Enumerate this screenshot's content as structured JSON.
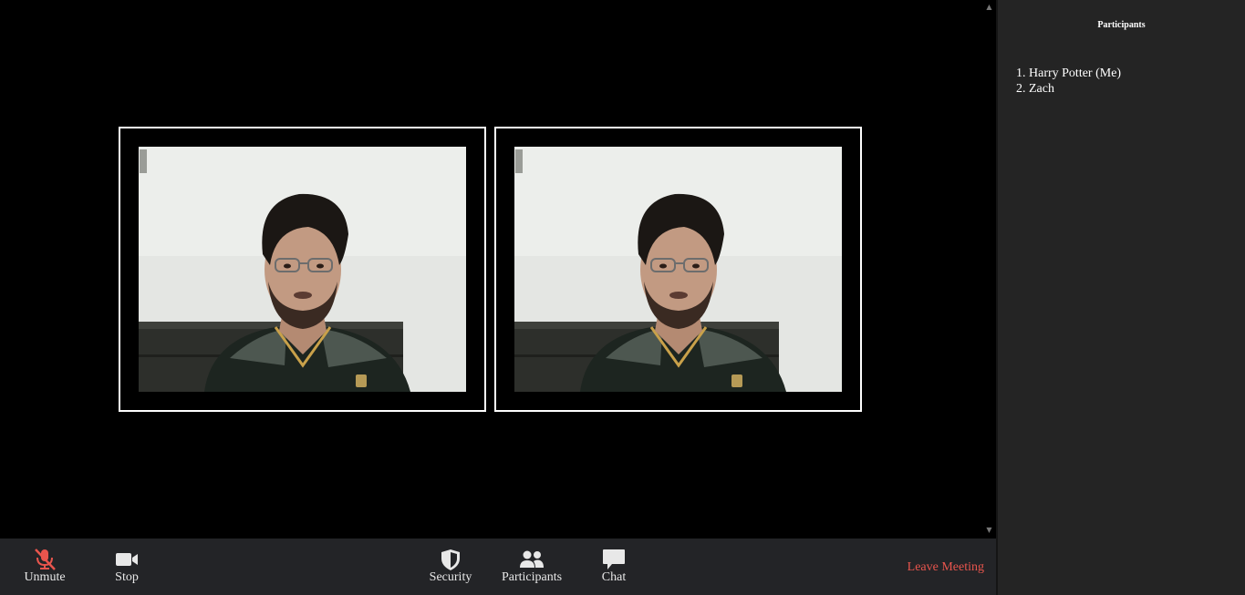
{
  "toolbar": {
    "unmute_label": "Unmute",
    "stop_label": "Stop",
    "security_label": "Security",
    "participants_label": "Participants",
    "chat_label": "Chat",
    "leave_label": "Leave Meeting",
    "icons": {
      "unmute": "muted-microphone-icon",
      "stop": "video-camera-icon",
      "security": "shield-icon",
      "participants": "people-icon",
      "chat": "chat-bubble-icon"
    },
    "colors": {
      "background": "#232427",
      "label": "#e8e8e8",
      "muted_icon": "#e8554d",
      "leave": "#e8554d"
    }
  },
  "video": {
    "tiles": [
      {
        "id": "tile-1"
      },
      {
        "id": "tile-2"
      }
    ],
    "tile_border_color": "#ffffff"
  },
  "participants_panel": {
    "title": "Participants",
    "items": [
      "1. Harry Potter (Me)",
      "2. Zach"
    ],
    "background": "#242424"
  }
}
